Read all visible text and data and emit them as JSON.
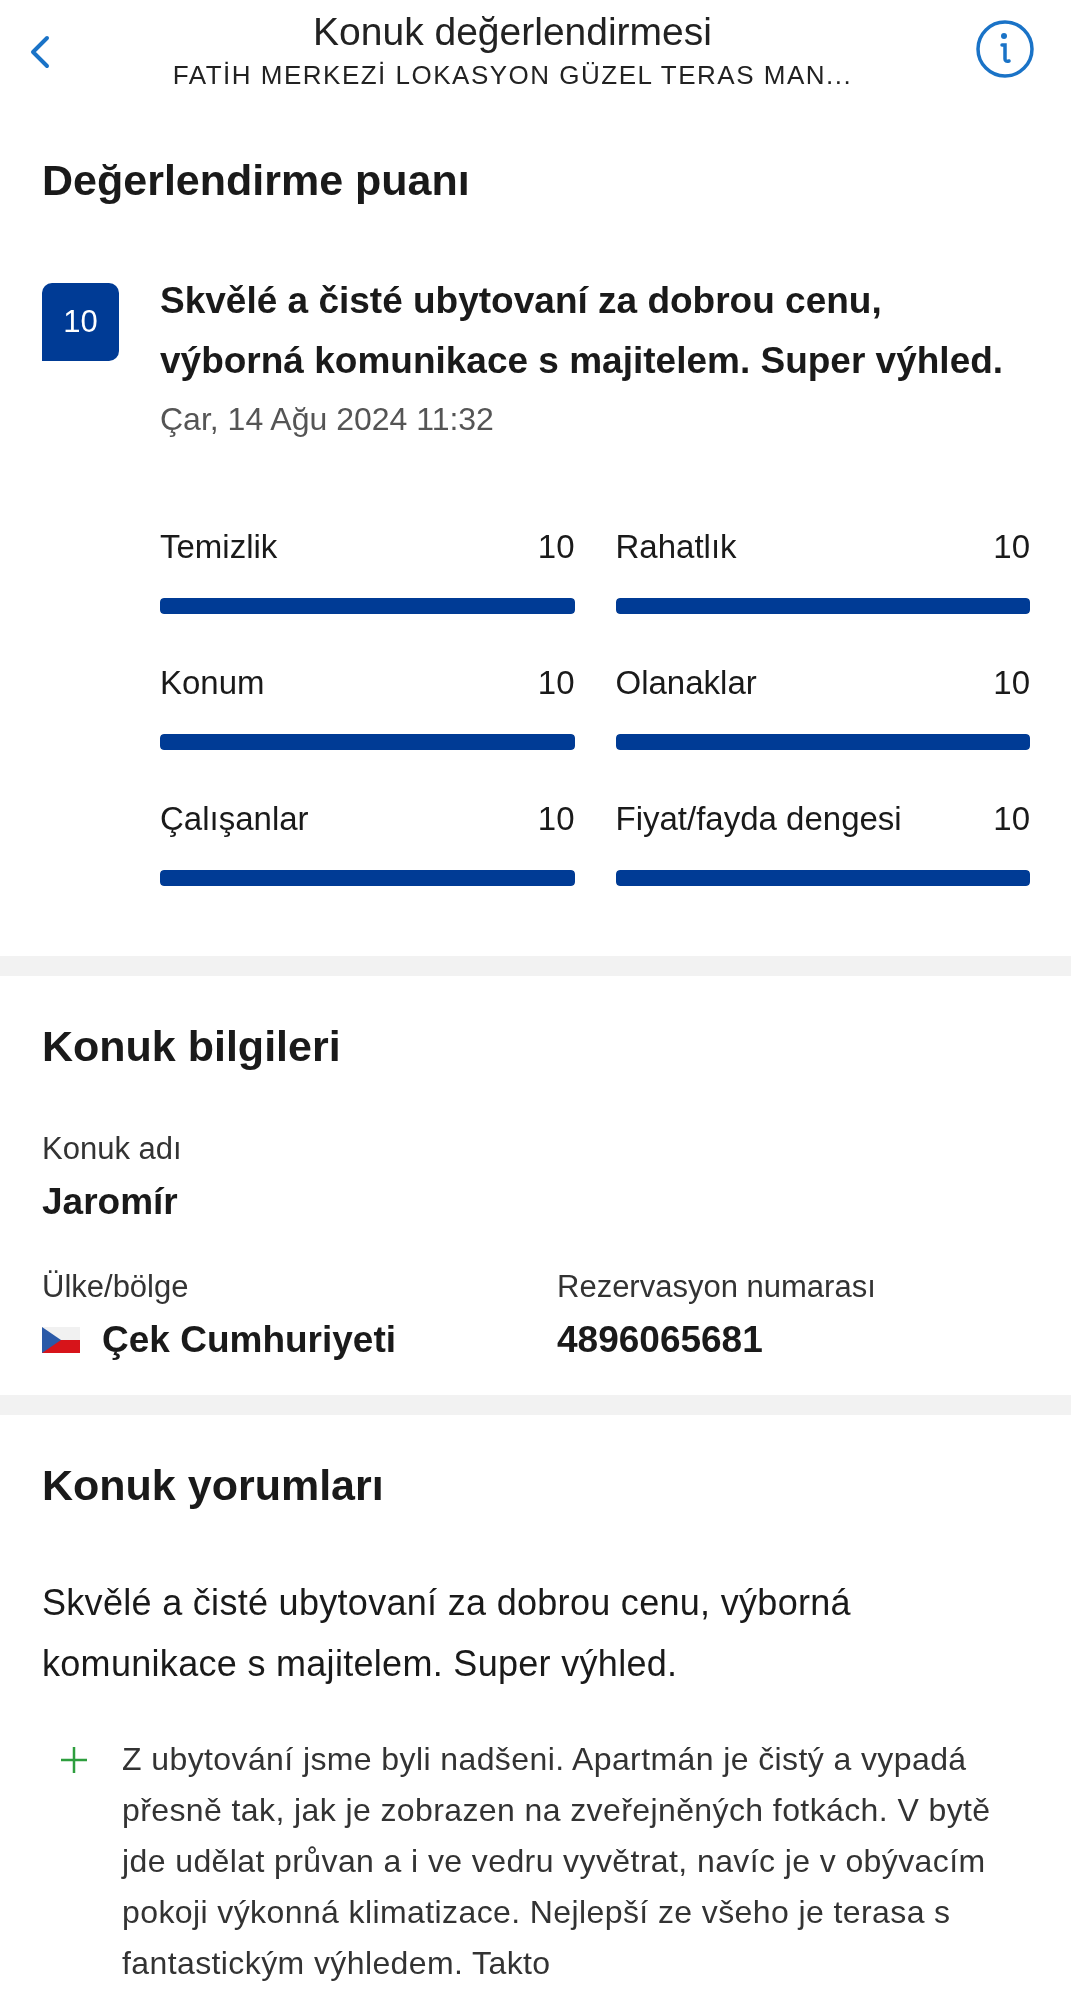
{
  "header": {
    "title": "Konuk değerlendirmesi",
    "subtitle": "FATİH MERKEZİ LOKASYON GÜZEL TERAS MAN..."
  },
  "rating": {
    "heading": "Değerlendirme puanı",
    "score": "10",
    "title": "Skvělé a čisté ubytovaní za dobrou cenu, výborná komunikace s majitelem. Super výhled.",
    "date": "Çar, 14 Ağu 2024 11:32",
    "categories": [
      {
        "name": "Temizlik",
        "score": "10",
        "level": 1
      },
      {
        "name": "Rahatlık",
        "score": "10",
        "level": 1
      },
      {
        "name": "Konum",
        "score": "10",
        "level": 1
      },
      {
        "name": "Olanaklar",
        "score": "10",
        "level": 1
      },
      {
        "name": "Çalışanlar",
        "score": "10",
        "level": 1
      },
      {
        "name": "Fiyat/fayda dengesi",
        "score": "10",
        "level": 1
      }
    ]
  },
  "guest": {
    "heading": "Konuk bilgileri",
    "name_label": "Konuk adı",
    "name": "Jaromír",
    "country_label": "Ülke/bölge",
    "country": "Çek Cumhuriyeti",
    "booking_label": "Rezervasyon numarası",
    "booking_number": "4896065681"
  },
  "comments": {
    "heading": "Konuk yorumları",
    "title": "Skvělé a čisté ubytovaní za dobrou cenu, výborná komunikace s majitelem. Super výhled.",
    "items": [
      {
        "kind": "positive",
        "text": "Z ubytování jsme byli nadšeni. Apartmán je čistý a vypadá přesně tak, jak je zobrazen na zveřejněných fotkách. V bytě jde udělat průvan a i ve vedru vyvětrat, navíc je v obývacím pokoji výkonná klimatizace. Nejlepší ze všeho je terasa s fantastickým výhledem. Takto"
      }
    ]
  }
}
